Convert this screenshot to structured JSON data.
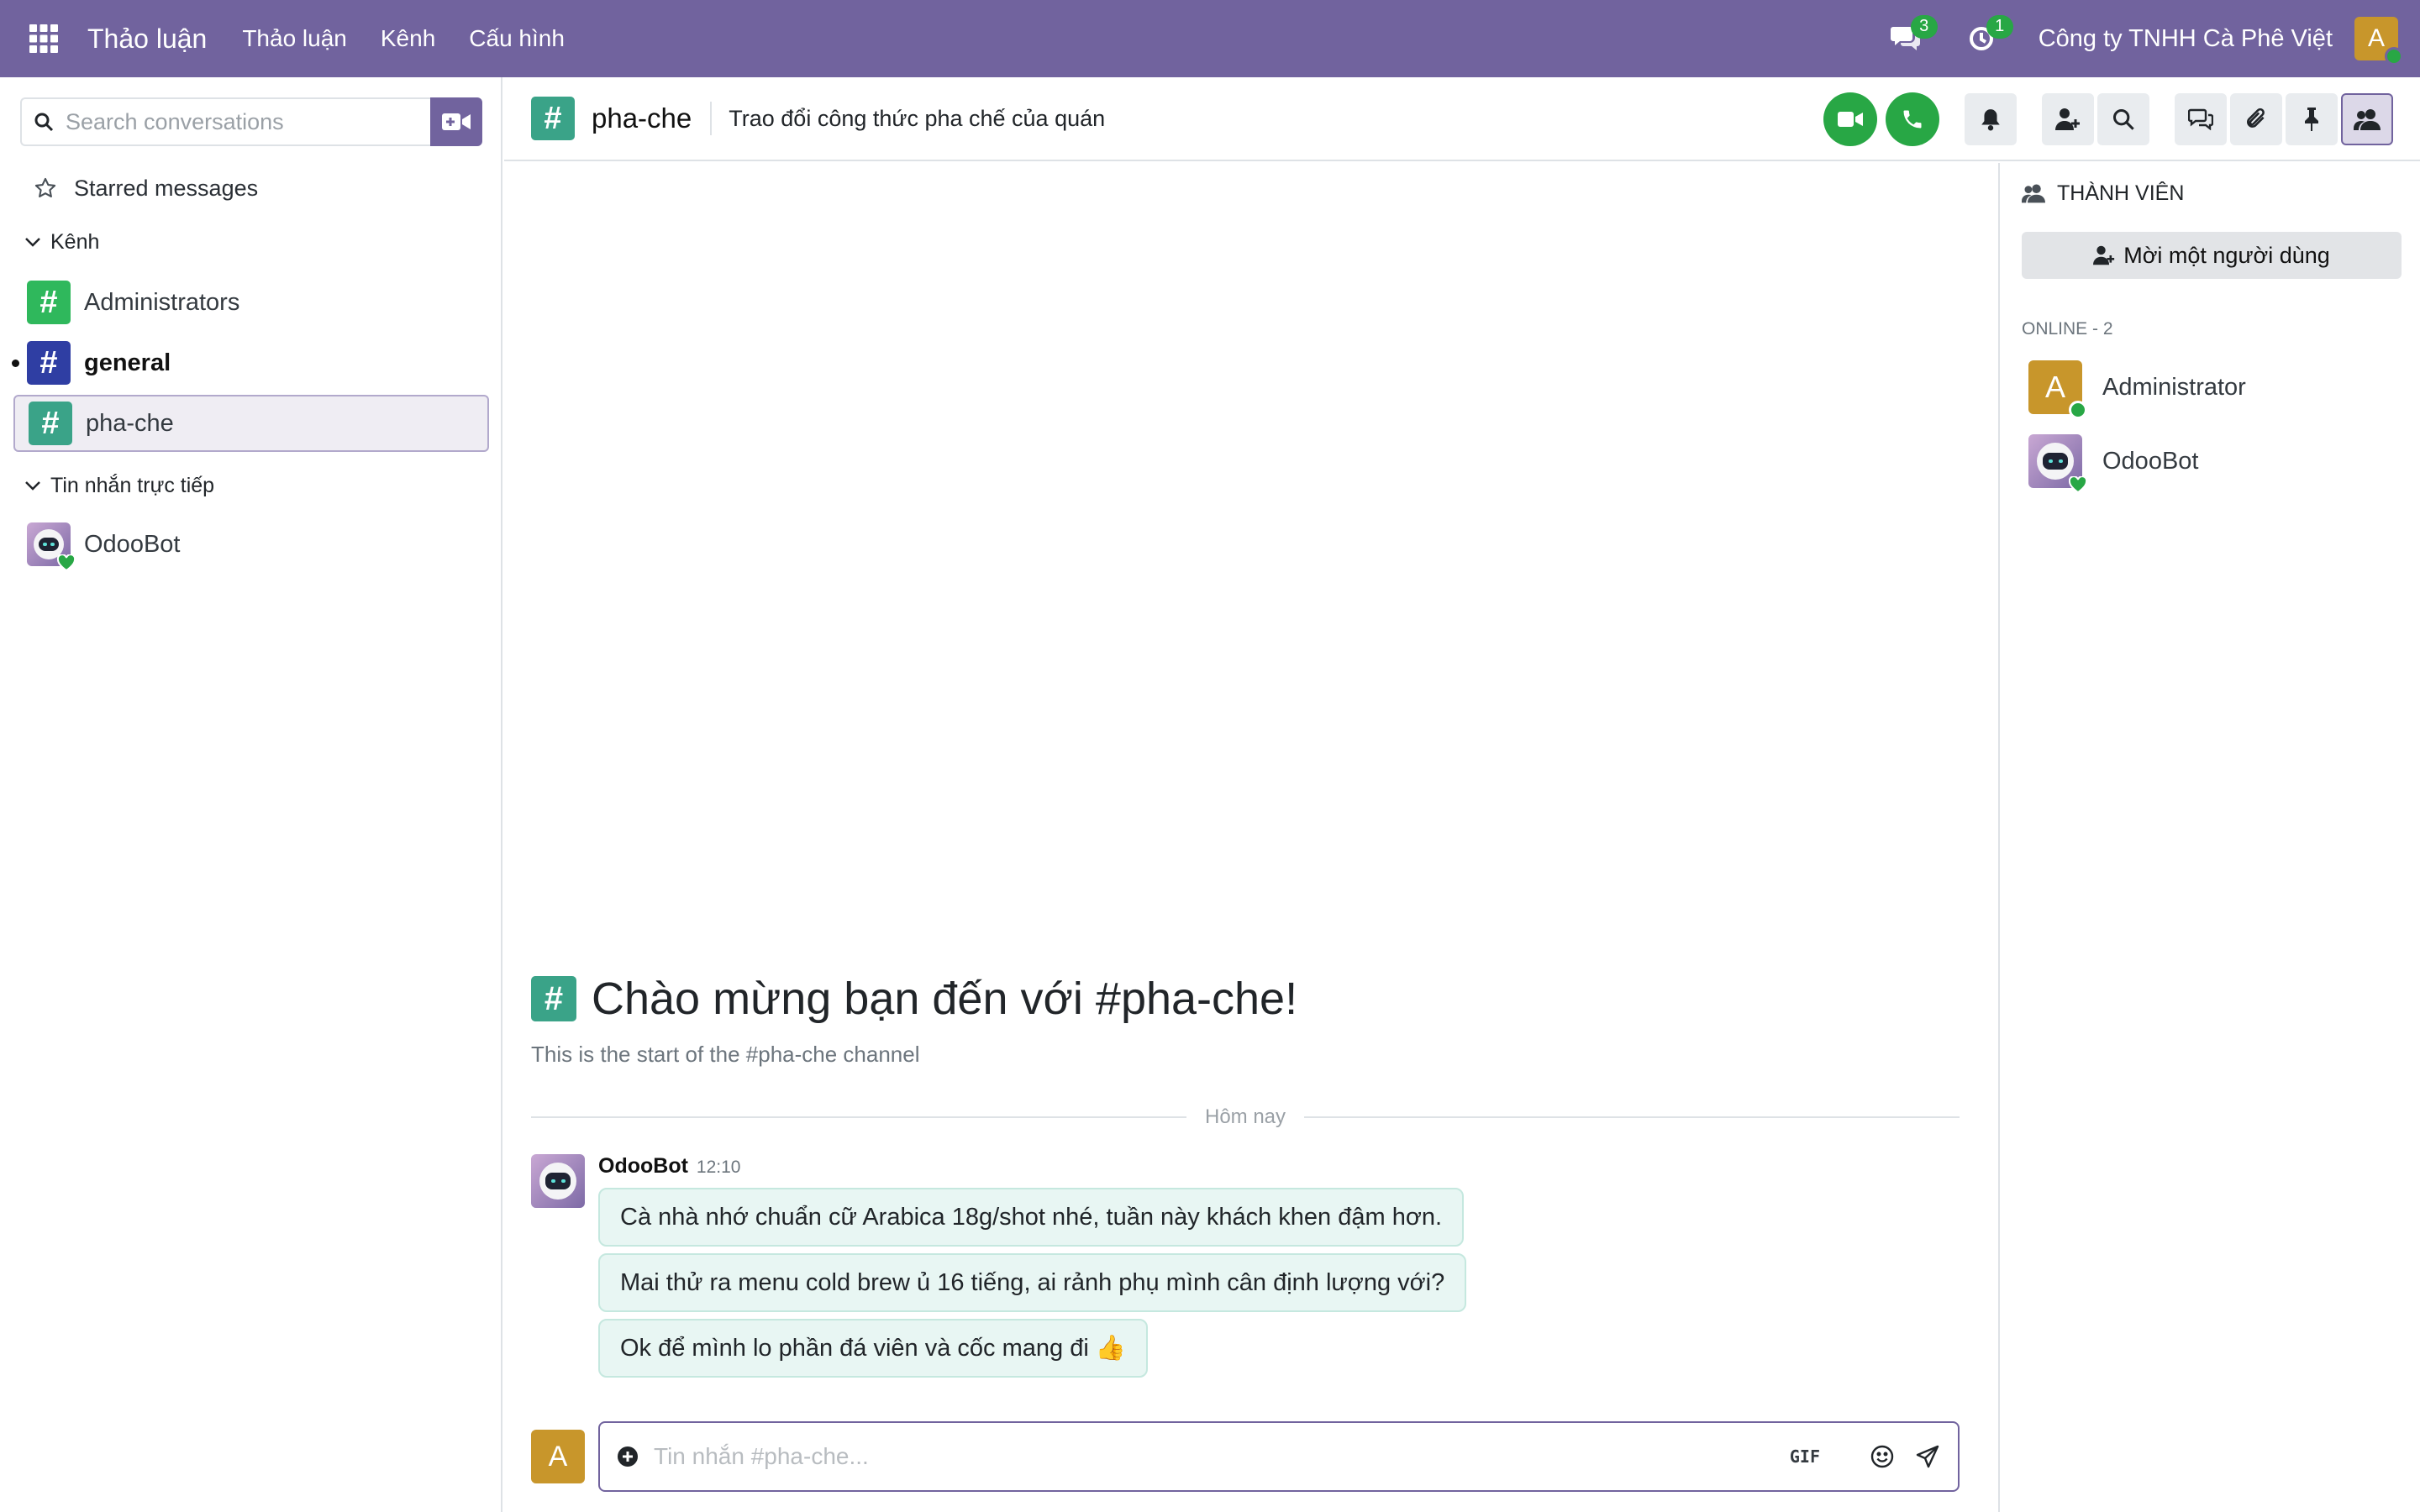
{
  "navbar": {
    "app_title": "Thảo luận",
    "menu": [
      "Thảo luận",
      "Kênh",
      "Cấu hình"
    ],
    "messages_count": "3",
    "activity_count": "1",
    "company": "Công ty TNHH Cà Phê Việt",
    "user_initial": "A"
  },
  "sidebar": {
    "search_placeholder": "Search conversations",
    "starred": "Starred messages",
    "channels_header": "Kênh",
    "channels": [
      {
        "name": "Administrators"
      },
      {
        "name": "general"
      },
      {
        "name": "pha-che"
      }
    ],
    "dm_header": "Tin nhắn trực tiếp",
    "direct_messages": [
      {
        "name": "OdooBot"
      }
    ]
  },
  "thread": {
    "name": "pha-che",
    "description": "Trao đổi công thức pha chế của quán",
    "welcome_title": "Chào mừng bạn đến với #pha-che!",
    "welcome_sub": "This is the start of the #pha-che channel",
    "date_separator": "Hôm nay",
    "messages": [
      {
        "author": "OdooBot",
        "time": "12:10",
        "lines": [
          "Cà nhà nhớ chuẩn cữ Arabica 18g/shot nhé, tuần này khách khen đậm hơn.",
          "Mai thử ra menu cold brew ủ 16 tiếng, ai rảnh phụ mình cân định lượng với?",
          "Ok để mình lo phần đá viên và cốc mang đi 👍"
        ]
      }
    ]
  },
  "composer": {
    "placeholder": "Tin nhắn #pha-che...",
    "gif_label": "GIF",
    "avatar_initial": "A"
  },
  "members_panel": {
    "title": "THÀNH VIÊN",
    "invite_label": "Mời một người dùng",
    "online_label": "ONLINE - 2",
    "members": [
      {
        "name": "Administrator",
        "initial": "A"
      },
      {
        "name": "OdooBot"
      }
    ]
  },
  "colors": {
    "brand": "#71639e",
    "online": "#28a745",
    "message_bg": "#e8f6f3",
    "avatar_admin": "#c8962b"
  }
}
